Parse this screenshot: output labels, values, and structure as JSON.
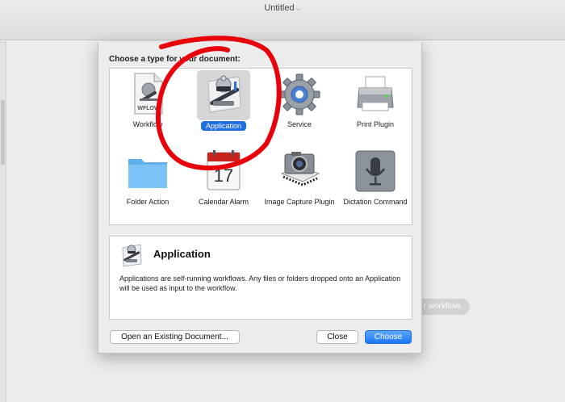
{
  "window": {
    "title": "Untitled"
  },
  "background": {
    "pill_text": "r workflow."
  },
  "dialog": {
    "prompt": "Choose a type for your document:",
    "types": [
      {
        "label": "Workflow",
        "icon": "wflow-document-icon",
        "badge": "WFLOW"
      },
      {
        "label": "Application",
        "icon": "automator-robot-icon",
        "selected": true
      },
      {
        "label": "Service",
        "icon": "gear-icon"
      },
      {
        "label": "Print Plugin",
        "icon": "printer-icon"
      },
      {
        "label": "Folder Action",
        "icon": "folder-icon"
      },
      {
        "label": "Calendar Alarm",
        "icon": "calendar-icon",
        "day": "17"
      },
      {
        "label": "Image Capture Plugin",
        "icon": "camera-icon"
      },
      {
        "label": "Dictation Command",
        "icon": "microphone-icon"
      }
    ],
    "description": {
      "title": "Application",
      "text": "Applications are self-running workflows. Any files or folders dropped onto an Application will be used as input to the workflow."
    },
    "buttons": {
      "open": "Open an Existing Document...",
      "close": "Close",
      "choose": "Choose"
    }
  },
  "colors": {
    "accent": "#1f6fe0",
    "annotation": "#e8000b"
  }
}
